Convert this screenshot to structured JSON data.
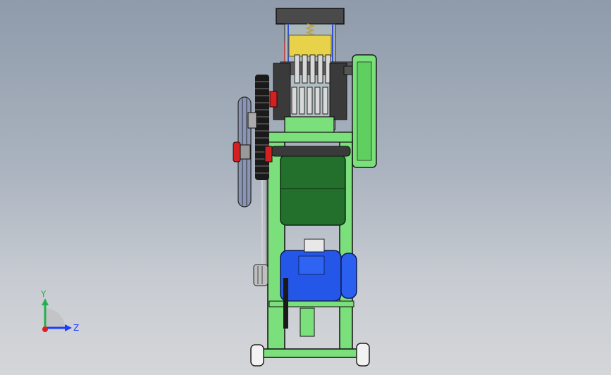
{
  "viewport": {
    "background_top": "#8f9bab",
    "background_bottom": "#d4d6d9"
  },
  "model": {
    "frame_color": "#7be07b",
    "frame_dark": "#2e7d32",
    "chamber_green": "#1f6e2a",
    "motor_color": "#2456e8",
    "roller_color": "#e0c93a",
    "gear_color": "#1a1a1a",
    "pulley_color": "#8a95b5"
  },
  "triad": {
    "y_label": "Y",
    "z_label": "Z",
    "y_color": "#22b14c",
    "z_color": "#1e3cff",
    "origin_color": "#e01e1e"
  }
}
